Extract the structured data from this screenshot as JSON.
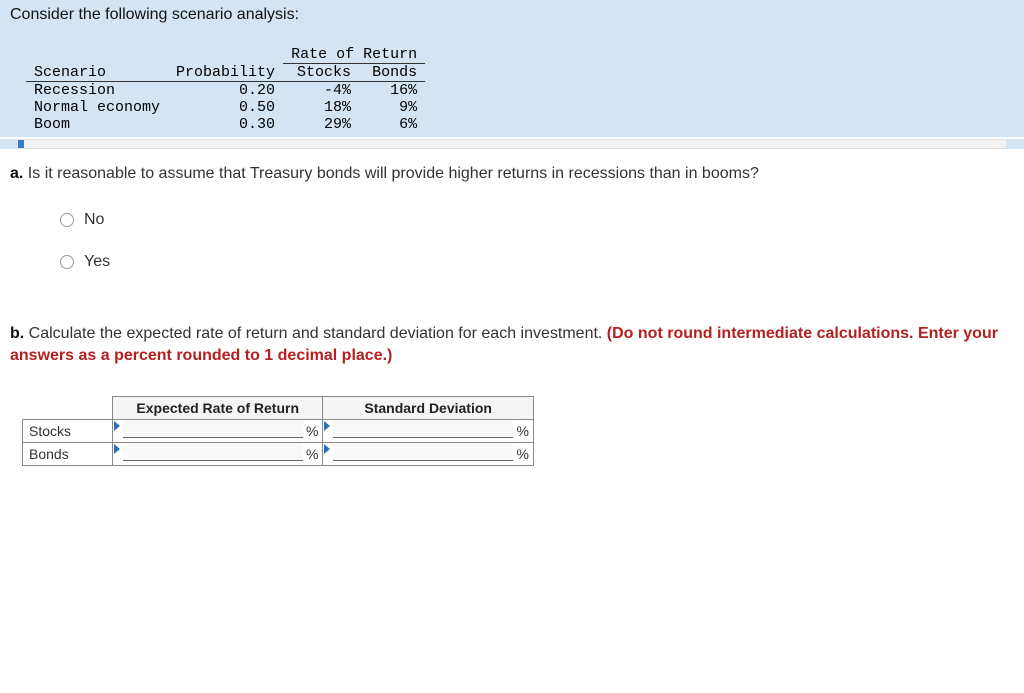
{
  "intro_text": "Consider the following scenario analysis:",
  "scenario_table": {
    "group_header": "Rate of Return",
    "headers": {
      "scenario": "Scenario",
      "probability": "Probability",
      "stocks": "Stocks",
      "bonds": "Bonds"
    },
    "rows": [
      {
        "scenario": "Recession",
        "probability": "0.20",
        "stocks": "-4%",
        "bonds": "16%"
      },
      {
        "scenario": "Normal economy",
        "probability": "0.50",
        "stocks": "18%",
        "bonds": "9%"
      },
      {
        "scenario": "Boom",
        "probability": "0.30",
        "stocks": "29%",
        "bonds": "6%"
      }
    ]
  },
  "question_a": {
    "num": "a.",
    "text": "Is it reasonable to assume that Treasury bonds will provide higher returns in recessions than in booms?",
    "options": {
      "no": "No",
      "yes": "Yes"
    }
  },
  "question_b": {
    "num": "b.",
    "text": "Calculate the expected rate of return and standard deviation for each investment. ",
    "instruction": "(Do not round intermediate calculations. Enter your answers as a percent rounded to 1 decimal place.)"
  },
  "answer_table": {
    "col1": "Expected Rate of Return",
    "col2": "Standard Deviation",
    "row1": "Stocks",
    "row2": "Bonds",
    "unit": "%"
  },
  "chart_data": {
    "type": "table",
    "title": "Scenario analysis: Rate of Return",
    "columns": [
      "Scenario",
      "Probability",
      "Stocks",
      "Bonds"
    ],
    "rows": [
      [
        "Recession",
        0.2,
        -4,
        16
      ],
      [
        "Normal economy",
        0.5,
        18,
        9
      ],
      [
        "Boom",
        0.3,
        29,
        6
      ]
    ],
    "units": {
      "Stocks": "%",
      "Bonds": "%"
    }
  }
}
